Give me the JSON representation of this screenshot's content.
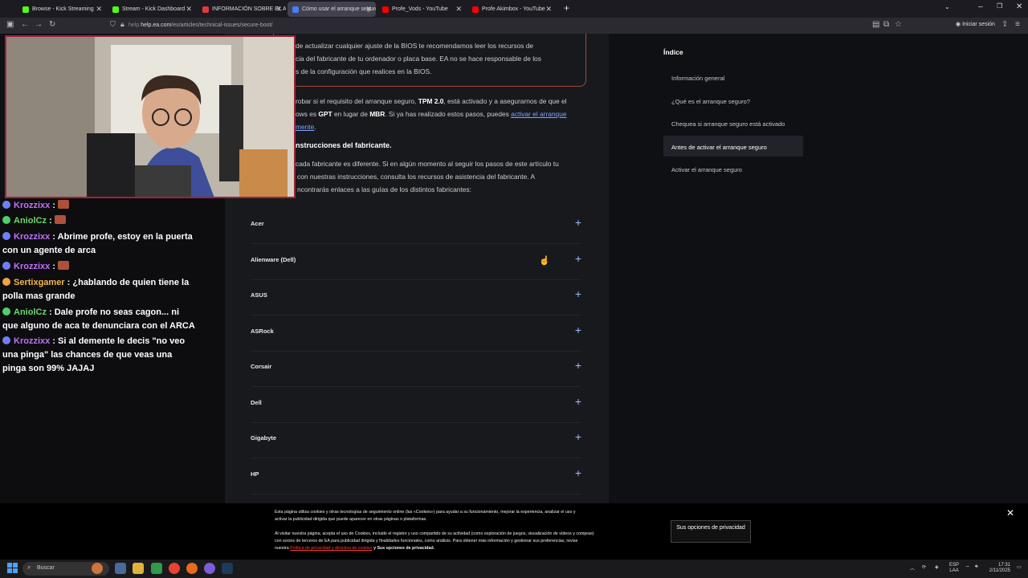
{
  "browser": {
    "tabs": [
      {
        "title": "Browse - Kick Streaming",
        "color": "#53fc18"
      },
      {
        "title": "Stream - Kick Dashboard",
        "color": "#53fc18"
      },
      {
        "title": "INFORMACIÓN SOBRE EL ARRA",
        "color": "#e23a3a"
      },
      {
        "title": "Cómo usar el arranque seguro -",
        "color": "#4a7cff"
      },
      {
        "title": "Profe_Vods - YouTube",
        "color": "#ff0000"
      },
      {
        "title": "Profe Akimbox - YouTube",
        "color": "#ff0000"
      }
    ],
    "url_host": "help.ea.com",
    "url_path": "/es/articles/technical-issues/secure-boot/",
    "signin": "Iniciar sesión"
  },
  "article": {
    "warning_lines": [
      "de actualizar cualquier ajuste de la BIOS te recomendamos leer los recursos de",
      "cia del fabricante de tu ordenador o placa base. EA no se hace responsable de los",
      "s de la configuración que realices en la BIOS."
    ],
    "p1_a": "robar si el requisito del arranque seguro, ",
    "p1_b": "TPM 2.0",
    "p1_c": ", está activado y a asegurarnos de que el",
    "p2_a": "ows es ",
    "p2_b": "GPT",
    "p2_c": " en lugar de ",
    "p2_d": "MBR",
    "p2_e": ". Si ya has realizado estos pasos, puedes ",
    "p2_link": "activar el arranque",
    "p3_link": "mente",
    "heading": "nstrucciones del fabricante.",
    "q1": "cada fabricante es diferente. Si en algún momento al seguir los pasos de este artículo tu",
    "q2": "con nuestras instrucciones, consulta los recursos de asistencia del fabricante. A",
    "q3": "ncontrarás enlaces a las guías de los distintos fabricantes:",
    "manufacturers": [
      "Acer",
      "Alienware (Dell)",
      "ASUS",
      "ASRock",
      "Corsair",
      "Dell",
      "Gigabyte",
      "HP"
    ]
  },
  "index": {
    "title": "Índice",
    "items": [
      "Información general",
      "¿Qué es el arranque seguro?",
      "Chequea si arranque seguro está activado",
      "Antes de activar el arranque seguro",
      "Activar el arranque seguro"
    ]
  },
  "chat": [
    {
      "user": "Krozzixx",
      "text": ":",
      "emote": true
    },
    {
      "user": "AniolCz",
      "text": ":",
      "emote": true
    },
    {
      "user": "Krozzixx",
      "text": ": Abrime profe, estoy en la puerta con un agente de arca"
    },
    {
      "user": "Krozzixx",
      "text": ":",
      "emote": true
    },
    {
      "user": "Sertixgamer",
      "text": ": ¿hablando de quien tiene la polla mas grande"
    },
    {
      "user": "AniolCz",
      "text": ": Dale profe no seas cagon... ni que alguno de aca te denunciara con el ARCA"
    },
    {
      "user": "Krozzixx",
      "text": ": Si al demente le decis \"no veo una pinga\" las chances de que veas una pinga son 99% JAJAJ"
    }
  ],
  "cookie": {
    "line1": "Esta página utiliza cookies y otras tecnologías de seguimiento online (las «Cookies») para ayudar a su funcionamiento, mejorar la experiencia, analizar el uso y",
    "line2": "activar la publicidad dirigida que puede aparecer en otras páginas o plataformas.",
    "line3": "Al visitar nuestra página, acepta el uso de Cookies, incluido el registro y uso compartido de su actividad (como exploración de juegos, visualización de vídeos y compras)",
    "line4": "con socios de terceros de EA para publicidad dirigida y finalidades funcionales, como análisis. Para obtener más información y gestionar sus preferencias, revise",
    "line5_a": "nuestra ",
    "line5_link": "Política de privacidad y directiva de cookies",
    "line5_b": " y Sus opciones de privacidad.",
    "button": "Sus opciones de privacidad"
  },
  "taskbar": {
    "search": "Buscar",
    "lang1": "ESP",
    "lang2": "LAA",
    "time": "17:31",
    "date": "2/11/2025"
  }
}
